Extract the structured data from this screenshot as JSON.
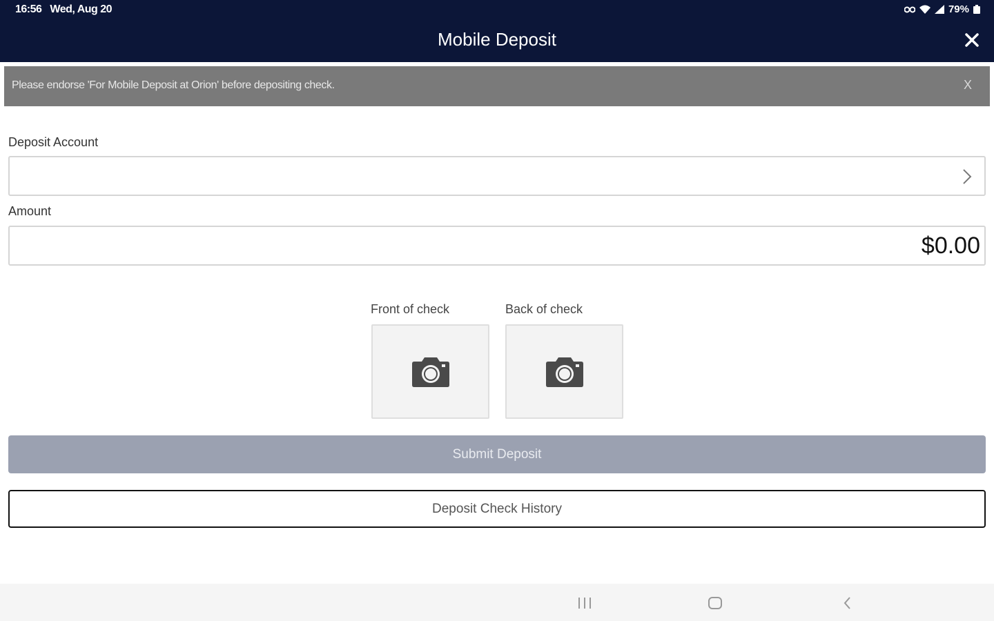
{
  "status_bar": {
    "time": "16:56",
    "date": "Wed, Aug 20",
    "battery": "79%"
  },
  "header": {
    "title": "Mobile Deposit"
  },
  "banner": {
    "message": "Please endorse 'For Mobile Deposit at Orion' before depositing check.",
    "close_label": "X"
  },
  "form": {
    "deposit_account_label": "Deposit Account",
    "amount_label": "Amount",
    "amount_value": "$0.00"
  },
  "check_capture": {
    "front_label": "Front of check",
    "back_label": "Back of check"
  },
  "actions": {
    "submit_label": "Submit Deposit",
    "history_label": "Deposit Check History"
  },
  "colors": {
    "header_bg": "#0c1638",
    "banner_bg": "#7a7a7a",
    "submit_bg": "#9ba1b1"
  }
}
